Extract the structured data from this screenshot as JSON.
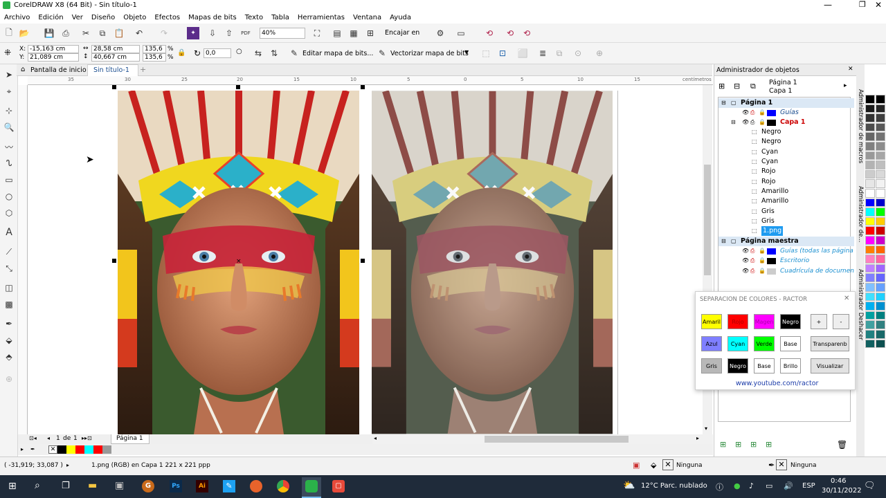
{
  "window": {
    "title": "CorelDRAW X8 (64 Bit) - Sin título-1"
  },
  "menu": [
    "Archivo",
    "Edición",
    "Ver",
    "Diseño",
    "Objeto",
    "Efectos",
    "Mapas de bits",
    "Texto",
    "Tabla",
    "Herramientas",
    "Ventana",
    "Ayuda"
  ],
  "toolbar": {
    "zoom": "40%",
    "snap_label": "Encajar en",
    "pdf": "PDF"
  },
  "props": {
    "x": "-15,163 cm",
    "y": "21,089 cm",
    "w": "28,58 cm",
    "h": "40,667 cm",
    "sx": "135,6",
    "sy": "135,6",
    "pct": "%",
    "angle": "0,0",
    "edit_bitmap": "Editar mapa de bits...",
    "trace_bitmap": "Vectorizar mapa de bits"
  },
  "tabs": {
    "home": "Pantalla de inicio",
    "doc": "Sin título-1"
  },
  "ruler": {
    "unit": "centímetros",
    "ticks": [
      "35",
      "30",
      "25",
      "20",
      "15",
      "10",
      "5",
      "0",
      "5",
      "10",
      "15"
    ]
  },
  "pagenav": {
    "current": "1",
    "of": "de",
    "total": "1",
    "page_tab": "Página 1"
  },
  "objmgr": {
    "title": "Administrador de objetos",
    "page": "Página 1",
    "layer": "Capa 1",
    "page1": "Página 1",
    "guides": "Guías",
    "capa1": "Capa 1",
    "objects": [
      "Negro",
      "Negro",
      "Cyan",
      "Cyan",
      "Rojo",
      "Rojo",
      "Amarillo",
      "Amarillo",
      "Gris",
      "Gris",
      "1.png"
    ],
    "master": "Página maestra",
    "master_items": [
      "Guías (todas las página",
      "Escritorio",
      "Cuadrícula de documen"
    ]
  },
  "dockers": [
    "Administrador de macros",
    "Administrador de...",
    "Administrador Deshacer"
  ],
  "sep": {
    "title": "SEPARACION DE COLORES - RACTOR",
    "row1": [
      "Amaril",
      "Rojo",
      "Magen",
      "Negro",
      "+",
      "-"
    ],
    "row2": [
      "Azul",
      "Cyan",
      "Verde",
      "Base",
      "Transparenb"
    ],
    "row3": [
      "Gris",
      "Negro",
      "Base",
      "Brillo",
      "Visualizar"
    ],
    "link": "www.youtube.com/ractor"
  },
  "status": {
    "coords": "( -31,919; 33,087 )",
    "info": "1.png (RGB) en Capa 1 221 x 221 ppp",
    "fill": "Ninguna",
    "outline": "Ninguna"
  },
  "taskbar": {
    "weather": "12°C  Parc. nublado",
    "lang": "ESP",
    "time": "0:46",
    "date": "30/11/2022"
  },
  "colors": {
    "accent": "#0078d7",
    "capa_red": "#cc0000",
    "link": "#1a3aa8"
  }
}
